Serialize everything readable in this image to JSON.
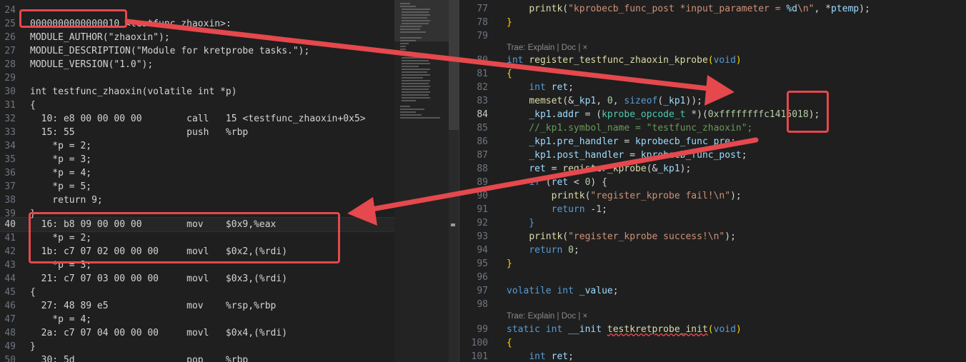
{
  "left_editor": {
    "lines": [
      {
        "n": "24",
        "text": ""
      },
      {
        "n": "25",
        "text": "0000000000000010 <testfunc_zhaoxin>:"
      },
      {
        "n": "26",
        "text": "MODULE_AUTHOR(\"zhaoxin\");"
      },
      {
        "n": "27",
        "text": "MODULE_DESCRIPTION(\"Module for kretprobe tasks.\");"
      },
      {
        "n": "28",
        "text": "MODULE_VERSION(\"1.0\");"
      },
      {
        "n": "29",
        "text": ""
      },
      {
        "n": "30",
        "text": "int testfunc_zhaoxin(volatile int *p)"
      },
      {
        "n": "31",
        "text": "{"
      },
      {
        "n": "32",
        "text": "  10: e8 00 00 00 00        call   15 <testfunc_zhaoxin+0x5>"
      },
      {
        "n": "33",
        "text": "  15: 55                    push   %rbp"
      },
      {
        "n": "34",
        "text": "    *p = 2;"
      },
      {
        "n": "35",
        "text": "    *p = 3;"
      },
      {
        "n": "36",
        "text": "    *p = 4;"
      },
      {
        "n": "37",
        "text": "    *p = 5;"
      },
      {
        "n": "38",
        "text": "    return 9;"
      },
      {
        "n": "39",
        "text": "}"
      },
      {
        "n": "40",
        "text": "  16: b8 09 00 00 00        mov    $0x9,%eax"
      },
      {
        "n": "41",
        "text": "    *p = 2;"
      },
      {
        "n": "42",
        "text": "  1b: c7 07 02 00 00 00     movl   $0x2,(%rdi)"
      },
      {
        "n": "43",
        "text": "    *p = 3;"
      },
      {
        "n": "44",
        "text": "  21: c7 07 03 00 00 00     movl   $0x3,(%rdi)"
      },
      {
        "n": "45",
        "text": "{"
      },
      {
        "n": "46",
        "text": "  27: 48 89 e5              mov    %rsp,%rbp"
      },
      {
        "n": "47",
        "text": "    *p = 4;"
      },
      {
        "n": "48",
        "text": "  2a: c7 07 04 00 00 00     movl   $0x4,(%rdi)"
      },
      {
        "n": "49",
        "text": "}"
      },
      {
        "n": "50",
        "text": "  30: 5d                    pop    %rbp"
      }
    ]
  },
  "right_editor": {
    "codelens": "Trae: Explain | Doc | ×",
    "lines": [
      {
        "n": "77",
        "text": "    printk(\"kprobecb_func_post *input_parameter = %d\\n\", *ptemp);"
      },
      {
        "n": "78",
        "text": "}"
      },
      {
        "n": "79",
        "text": ""
      },
      {
        "n": "80",
        "text": "int register_testfunc_zhaoxin_kprobe(void)"
      },
      {
        "n": "81",
        "text": "{"
      },
      {
        "n": "82",
        "text": "    int ret;"
      },
      {
        "n": "83",
        "text": "    memset(&_kp1, 0, sizeof(_kp1));"
      },
      {
        "n": "84",
        "text": "    _kp1.addr = (kprobe_opcode_t *)(0xffffffffc1415018);"
      },
      {
        "n": "85",
        "text": "    //_kp1.symbol_name = \"testfunc_zhaoxin\";"
      },
      {
        "n": "86",
        "text": "    _kp1.pre_handler = kprobecb_func_pre;"
      },
      {
        "n": "87",
        "text": "    _kp1.post_handler = kprobecb_func_post;"
      },
      {
        "n": "88",
        "text": "    ret = register_kprobe(&_kp1);"
      },
      {
        "n": "89",
        "text": "    if (ret < 0) {"
      },
      {
        "n": "90",
        "text": "        printk(\"register_kprobe fail!\\n\");"
      },
      {
        "n": "91",
        "text": "        return -1;"
      },
      {
        "n": "92",
        "text": "    }"
      },
      {
        "n": "93",
        "text": "    printk(\"register_kprobe success!\\n\");"
      },
      {
        "n": "94",
        "text": "    return 0;"
      },
      {
        "n": "95",
        "text": "}"
      },
      {
        "n": "96",
        "text": ""
      },
      {
        "n": "97",
        "text": "volatile int _value;"
      },
      {
        "n": "98",
        "text": ""
      },
      {
        "n": "99",
        "text": "static int __init testkretprobe_init(void)"
      },
      {
        "n": "100",
        "text": "{"
      },
      {
        "n": "101",
        "text": "    int ret;"
      }
    ]
  },
  "colors": {
    "annotation_red": "#e5484d",
    "background": "#1f1f1f"
  }
}
